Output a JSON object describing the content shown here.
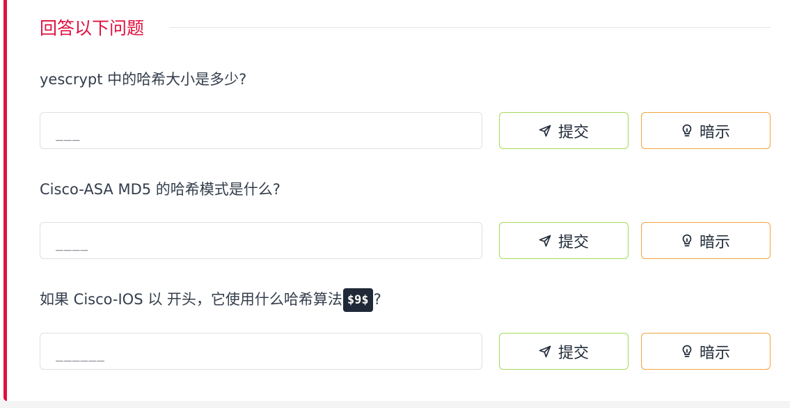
{
  "section": {
    "title": "回答以下问题"
  },
  "questions": [
    {
      "text": "yescrypt 中的哈希大小是多少?",
      "answer_placeholder": "___",
      "submit_label": "提交",
      "hint_label": "暗示"
    },
    {
      "text": "Cisco-ASA MD5 的哈希模式是什么?",
      "answer_placeholder": "____",
      "submit_label": "提交",
      "hint_label": "暗示"
    },
    {
      "text_before": "如果 Cisco-IOS 以 开头，它使用什么哈希算法",
      "code": "$9$",
      "text_after": "?",
      "answer_placeholder": "______",
      "submit_label": "提交",
      "hint_label": "暗示"
    }
  ],
  "icons": {
    "submit": "send-icon",
    "hint": "lightbulb-icon"
  },
  "colors": {
    "accent": "#e0103f",
    "submit_border": "#a3d959",
    "hint_border": "#f0a23a",
    "code_badge_bg": "#1f2937"
  }
}
